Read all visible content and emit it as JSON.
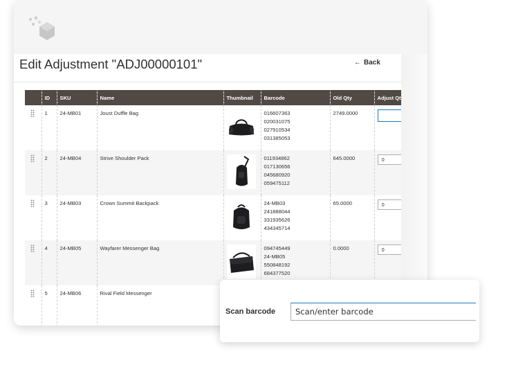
{
  "header": {
    "title": "Edit Adjustment \"ADJ00000101\"",
    "back_label": "Back",
    "logo_icon": "cube-dots-logo"
  },
  "grid": {
    "columns": [
      "",
      "ID",
      "SKU",
      "Name",
      "Thumbnail",
      "Barcode",
      "Old Qty",
      "Adjust Qty"
    ],
    "rows": [
      {
        "id": "1",
        "sku": "24-MB01",
        "name": "Joust Duffle Bag",
        "thumbnail": "duffle-bag-icon",
        "barcodes": [
          "016607363",
          "020031075",
          "027910534",
          "031385053"
        ],
        "old_qty": "2749.0000",
        "adjust_qty": ""
      },
      {
        "id": "2",
        "sku": "24-MB04",
        "name": "Strive Shoulder Pack",
        "thumbnail": "shoulder-pack-icon",
        "barcodes": [
          "011934862",
          "017130656",
          "045680920",
          "059475112"
        ],
        "old_qty": "645.0000",
        "adjust_qty": "0"
      },
      {
        "id": "3",
        "sku": "24-MB03",
        "name": "Crown Summit Backpack",
        "thumbnail": "backpack-icon",
        "barcodes": [
          "24-MB03",
          "241888044",
          "331935626",
          "434345714"
        ],
        "old_qty": "65.0000",
        "adjust_qty": "0"
      },
      {
        "id": "4",
        "sku": "24-MB05",
        "name": "Wayfarer Messenger Bag",
        "thumbnail": "messenger-bag-icon",
        "barcodes": [
          "094745449",
          "24-MB05",
          "550848192",
          "684377520"
        ],
        "old_qty": "0.0000",
        "adjust_qty": "0"
      },
      {
        "id": "5",
        "sku": "24-MB06",
        "name": "Rival Field Messenger",
        "thumbnail": "",
        "barcodes": [],
        "old_qty": "",
        "adjust_qty": ""
      }
    ]
  },
  "scan": {
    "label": "Scan barcode",
    "placeholder": "Scan/enter barcode"
  },
  "colors": {
    "header_bg": "#514943",
    "accent": "#1979c3",
    "row_alt": "#f5f5f5"
  }
}
